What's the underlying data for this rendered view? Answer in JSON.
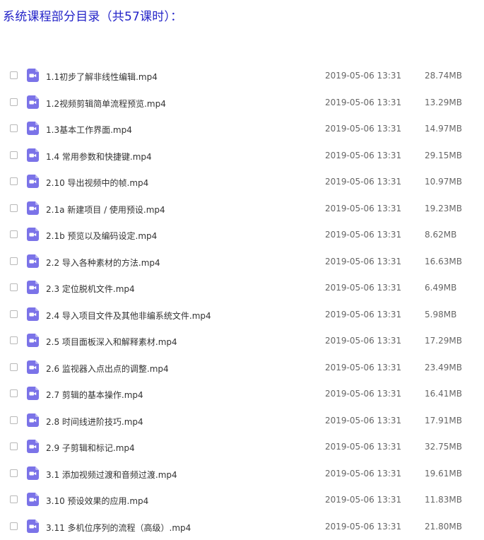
{
  "page": {
    "title": "系统课程部分目录（共57课时）："
  },
  "colors": {
    "title": "#2323c8",
    "icon_fill": "#7b73e8",
    "file_text": "#333333",
    "meta_text": "#666666"
  },
  "icons": {
    "file_icon": "video-file-icon"
  },
  "files": [
    {
      "name": "1.1初步了解非线性编辑.mp4",
      "date": "2019-05-06 13:31",
      "size": "28.74MB"
    },
    {
      "name": "1.2视频剪辑简单流程预览.mp4",
      "date": "2019-05-06 13:31",
      "size": "13.29MB"
    },
    {
      "name": "1.3基本工作界面.mp4",
      "date": "2019-05-06 13:31",
      "size": "14.97MB"
    },
    {
      "name": "1.4 常用参数和快捷键.mp4",
      "date": "2019-05-06 13:31",
      "size": "29.15MB"
    },
    {
      "name": "2.10 导出视频中的帧.mp4",
      "date": "2019-05-06 13:31",
      "size": "10.97MB"
    },
    {
      "name": "2.1a 新建项目 / 使用预设.mp4",
      "date": "2019-05-06 13:31",
      "size": "19.23MB"
    },
    {
      "name": "2.1b 预览以及编码设定.mp4",
      "date": "2019-05-06 13:31",
      "size": "8.62MB"
    },
    {
      "name": "2.2 导入各种素材的方法.mp4",
      "date": "2019-05-06 13:31",
      "size": "16.63MB"
    },
    {
      "name": "2.3 定位脱机文件.mp4",
      "date": "2019-05-06 13:31",
      "size": "6.49MB"
    },
    {
      "name": "2.4 导入项目文件及其他非编系统文件.mp4",
      "date": "2019-05-06 13:31",
      "size": "5.98MB"
    },
    {
      "name": "2.5 项目面板深入和解释素材.mp4",
      "date": "2019-05-06 13:31",
      "size": "17.29MB"
    },
    {
      "name": "2.6 监视器入点出点的调整.mp4",
      "date": "2019-05-06 13:31",
      "size": "23.49MB"
    },
    {
      "name": "2.7 剪辑的基本操作.mp4",
      "date": "2019-05-06 13:31",
      "size": "16.41MB"
    },
    {
      "name": "2.8 时间线进阶技巧.mp4",
      "date": "2019-05-06 13:31",
      "size": "17.91MB"
    },
    {
      "name": "2.9 子剪辑和标记.mp4",
      "date": "2019-05-06 13:31",
      "size": "32.75MB"
    },
    {
      "name": "3.1 添加视频过渡和音频过渡.mp4",
      "date": "2019-05-06 13:31",
      "size": "19.61MB"
    },
    {
      "name": "3.10 预设效果的应用.mp4",
      "date": "2019-05-06 13:31",
      "size": "11.83MB"
    },
    {
      "name": "3.11 多机位序列的流程（高级）.mp4",
      "date": "2019-05-06 13:31",
      "size": "21.80MB"
    }
  ]
}
